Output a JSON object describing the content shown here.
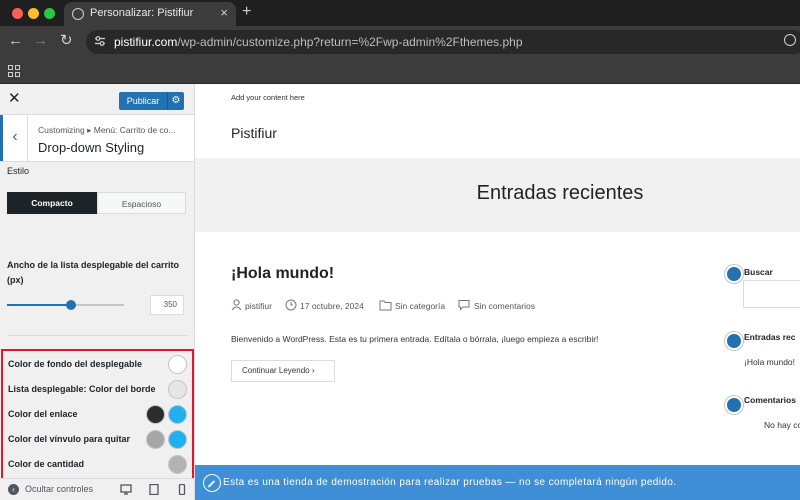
{
  "browser": {
    "tab_title": "Personalizar: Pistifiur",
    "url_host": "pistifiur.com",
    "url_path": "/wp-admin/customize.php?return=%2Fwp-admin%2Fthemes.php"
  },
  "customizer": {
    "publish_label": "Publicar",
    "breadcrumb": "Customizing ▸ Menú: Carrito de co...",
    "section_title": "Drop-down Styling",
    "style_label": "Estilo",
    "style_options": [
      "Compacto",
      "Espacioso"
    ],
    "style_selected": "Compacto",
    "width_label": "Ancho de la lista desplegable del carrito (px)",
    "width_value": "350",
    "width_slider_fraction": 0.55,
    "color_settings": [
      {
        "label": "Color de fondo del desplegable",
        "swatches": [
          "#ffffff"
        ]
      },
      {
        "label": "Lista desplegable: Color del borde",
        "swatches": [
          "#e6e6e6"
        ]
      },
      {
        "label": "Color del enlace",
        "swatches": [
          "#2c2c2c",
          "#1fb0f0"
        ]
      },
      {
        "label": "Color del vínvulo para quitar",
        "swatches": [
          "#a6a6a6",
          "#1fb0f0"
        ]
      },
      {
        "label": "Color de cantidad",
        "swatches": [
          "#b3b3b3"
        ]
      }
    ],
    "hide_controls_label": "Ocultar controles"
  },
  "preview": {
    "add_content": "Add your content here",
    "site_title": "Pistifiur",
    "hero_title": "Entradas recientes",
    "post": {
      "title": "¡Hola mundo!",
      "author": "pistifiur",
      "date": "17 octubre, 2024",
      "category": "Sin categoría",
      "comments": "Sin comentarios",
      "excerpt": "Bienvenido a WordPress. Esta es tu primera entrada. Edítala o bórrala, ¡luego empieza a escribir!",
      "read_more": "Continuar Leyendo"
    },
    "sidebar_widgets": {
      "search_title": "Buscar",
      "recent_title": "Entradas rec",
      "recent_item": "¡Hola mundo!",
      "comments_title": "Comentarios",
      "comments_text": "No hay co"
    },
    "demo_notice": "Esta es una tienda de demostración para realizar pruebas — no se completará ningún pedido."
  },
  "colors": {
    "wp_blue": "#2271b1",
    "highlight_red": "#e2172e",
    "demo_bar": "#3e8fd6"
  }
}
